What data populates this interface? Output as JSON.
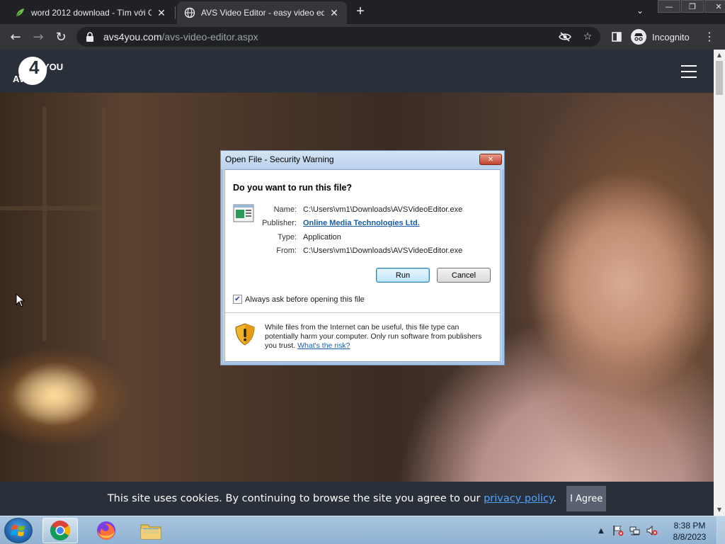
{
  "browser": {
    "tabs": [
      {
        "title": "word 2012 download - Tìm với G",
        "icon": "google-leaf-icon"
      },
      {
        "title": "AVS Video Editor - easy video ed",
        "icon": "globe-icon"
      }
    ],
    "url_host": "avs4you.com",
    "url_path": "/avs-video-editor.aspx",
    "incognito_label": "Incognito"
  },
  "site": {
    "logo_text_avs": "AVS",
    "logo_text_4": "4",
    "logo_text_you": "YOU"
  },
  "dialog": {
    "title": "Open File - Security Warning",
    "question": "Do you want to run this file?",
    "fields": [
      {
        "label": "Name:",
        "value": "C:\\Users\\vm1\\Downloads\\AVSVideoEditor.exe"
      },
      {
        "label": "Publisher:",
        "value": "Online Media Technologies Ltd."
      },
      {
        "label": "Type:",
        "value": "Application"
      },
      {
        "label": "From:",
        "value": "C:\\Users\\vm1\\Downloads\\AVSVideoEditor.exe"
      }
    ],
    "run_label": "Run",
    "cancel_label": "Cancel",
    "always_ask_label": "Always ask before opening this file",
    "always_ask_checked": true,
    "warning_text": "While files from the Internet can be useful, this file type can potentially harm your computer. Only run software from publishers you trust.",
    "risk_link": "What's the risk?"
  },
  "cookie": {
    "text": "This site uses cookies. By continuing to browse the site you agree to our",
    "link": "privacy policy",
    "after": ".",
    "button": "I Agree"
  },
  "taskbar": {
    "time": "8:38 PM",
    "date": "8/8/2023"
  },
  "colors": {
    "chrome_bg": "#202124",
    "toolbar_bg": "#35363a",
    "site_header": "#2a3039",
    "link_blue": "#4ea3ff",
    "dialog_link": "#1a5ea5"
  }
}
